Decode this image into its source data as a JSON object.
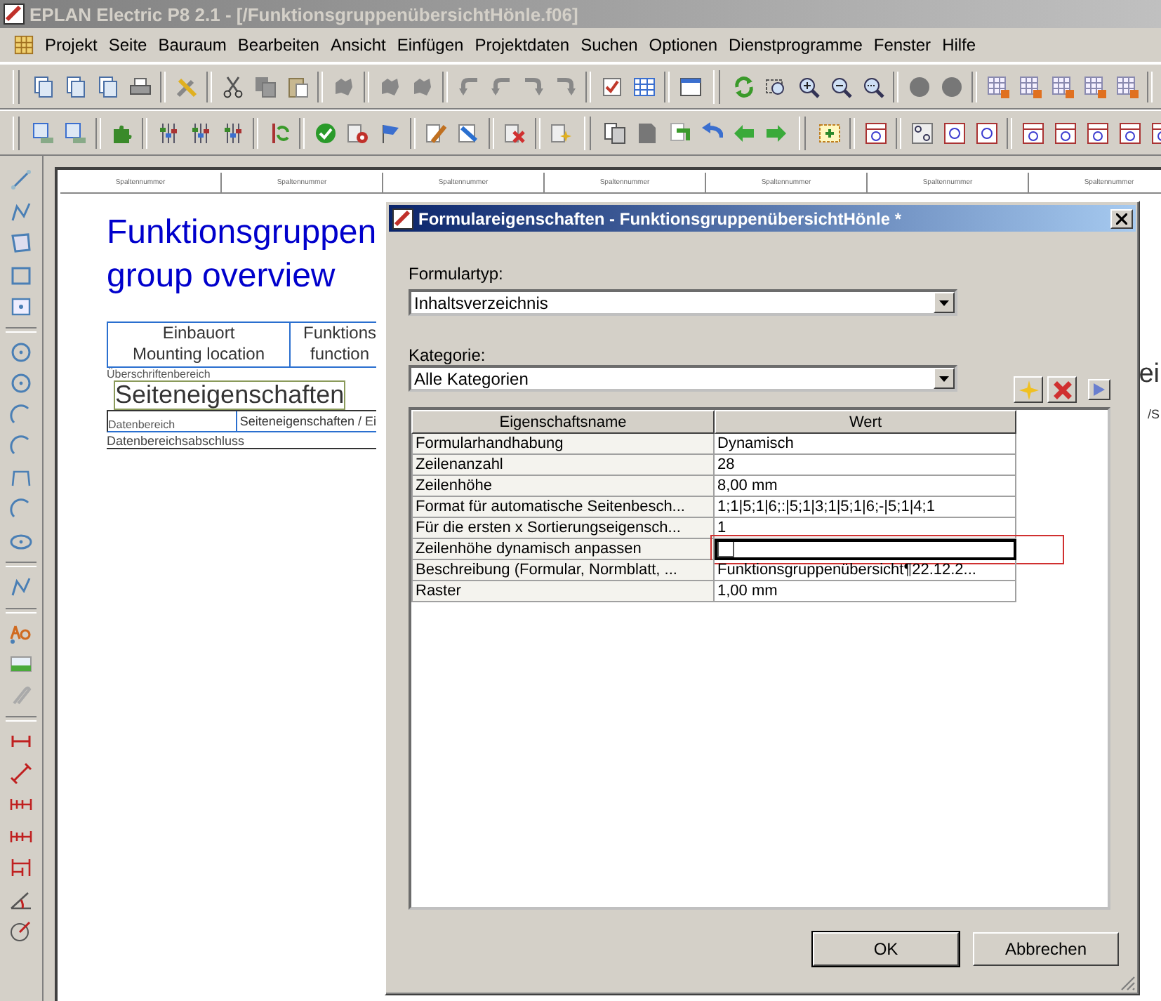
{
  "app_title": "EPLAN Electric P8 2.1 - [/FunktionsgruppenübersichtHönle.f06]",
  "menu": [
    "Projekt",
    "Seite",
    "Bauraum",
    "Bearbeiten",
    "Ansicht",
    "Einfügen",
    "Projektdaten",
    "Suchen",
    "Optionen",
    "Dienstprogramme",
    "Fenster",
    "Hilfe"
  ],
  "page": {
    "column_headers": [
      "Spaltennummer",
      "Spaltennummer",
      "Spaltennummer",
      "Spaltennummer",
      "Spaltennummer",
      "Spaltennummer",
      "Spaltennummer"
    ],
    "title_lines": [
      "Funktionsgruppen",
      "group overview"
    ],
    "header_cells": [
      {
        "line1": "Einbauort",
        "line2": "Mounting location"
      },
      {
        "line1": "Funktions",
        "line2": "function"
      }
    ],
    "header_area_label": "Überschriftenbereich",
    "data_area_label": "Datenbereich",
    "placeholder_text": "Seiteneigenschaften",
    "data_cell": "Seiteneigenschaften / Ei",
    "footer_area_label": "Datenbereichsabschluss",
    "right_fragments": [
      "ei",
      "/S"
    ]
  },
  "dialog": {
    "title": "Formulareigenschaften - FunktionsgruppenübersichtHönle *",
    "form_type": {
      "label": "Formulartyp:",
      "value": "Inhaltsverzeichnis"
    },
    "category": {
      "label": "Kategorie:",
      "value": "Alle Kategorien"
    },
    "columns": [
      "Eigenschaftsname",
      "Wert"
    ],
    "rows": [
      {
        "name": "Formularhandhabung",
        "kind": "text",
        "value": "Dynamisch",
        "selected": false
      },
      {
        "name": "Zeilenanzahl",
        "kind": "text",
        "value": "28",
        "selected": false
      },
      {
        "name": "Zeilenhöhe",
        "kind": "text",
        "value": "8,00 mm",
        "selected": false
      },
      {
        "name": "Format für automatische Seitenbesch...",
        "kind": "text",
        "value": "1;1|5;1|6;:|5;1|3;1|5;1|6;-|5;1|4;1",
        "selected": false
      },
      {
        "name": "Für die ersten x Sortierungseigensch...",
        "kind": "text",
        "value": "1",
        "selected": false
      },
      {
        "name": "Zeilenhöhe dynamisch anpassen",
        "kind": "checkbox",
        "checked": false,
        "selected": true
      },
      {
        "name": "Beschreibung (Formular, Normblatt, ...",
        "kind": "text",
        "value": "Funktionsgruppenübersicht¶22.12.2...",
        "selected": false
      },
      {
        "name": "Raster",
        "kind": "text",
        "value": "1,00 mm",
        "selected": false
      }
    ],
    "buttons": [
      "OK",
      "Abbrechen"
    ]
  }
}
